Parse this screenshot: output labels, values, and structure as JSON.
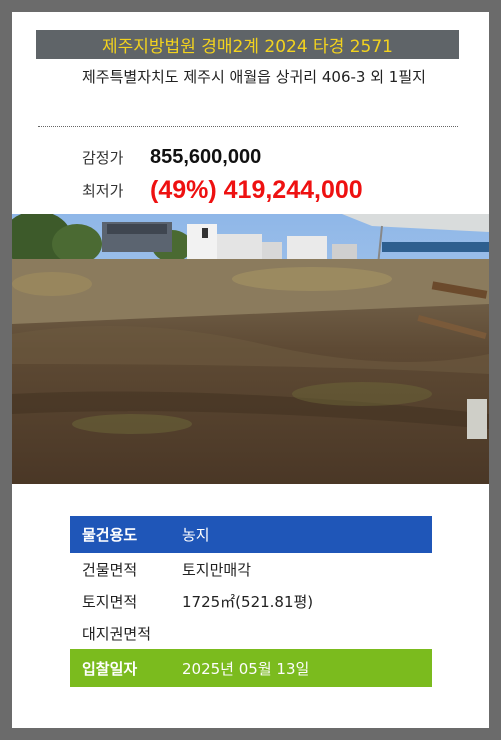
{
  "header": {
    "title": "제주지방법원 경매2계 2024 타경 2571"
  },
  "property": {
    "address": "제주특별자치도 제주시 애월읍 상귀리 406-3 외 1필지",
    "appraisal_label": "감정가",
    "appraisal_value": "855,600,000",
    "minimum_label": "최저가",
    "minimum_value": "(49%) 419,244,000"
  },
  "details": {
    "usage_label": "물건용도",
    "usage_value": "농지",
    "building_area_label": "건물면적",
    "building_area_value": "토지만매각",
    "land_area_label": "토지면적",
    "land_area_value": "1725㎡(521.81평)",
    "land_right_label": "대지권면적",
    "land_right_value": "",
    "bid_date_label": "입찰일자",
    "bid_date_value": "2025년 05월 13일"
  },
  "colors": {
    "title_bg": "#5f6468",
    "title_text": "#f2d21e",
    "minimum_price": "#ee1111",
    "usage_row": "#1f56b8",
    "bid_row": "#7bbb1e"
  }
}
